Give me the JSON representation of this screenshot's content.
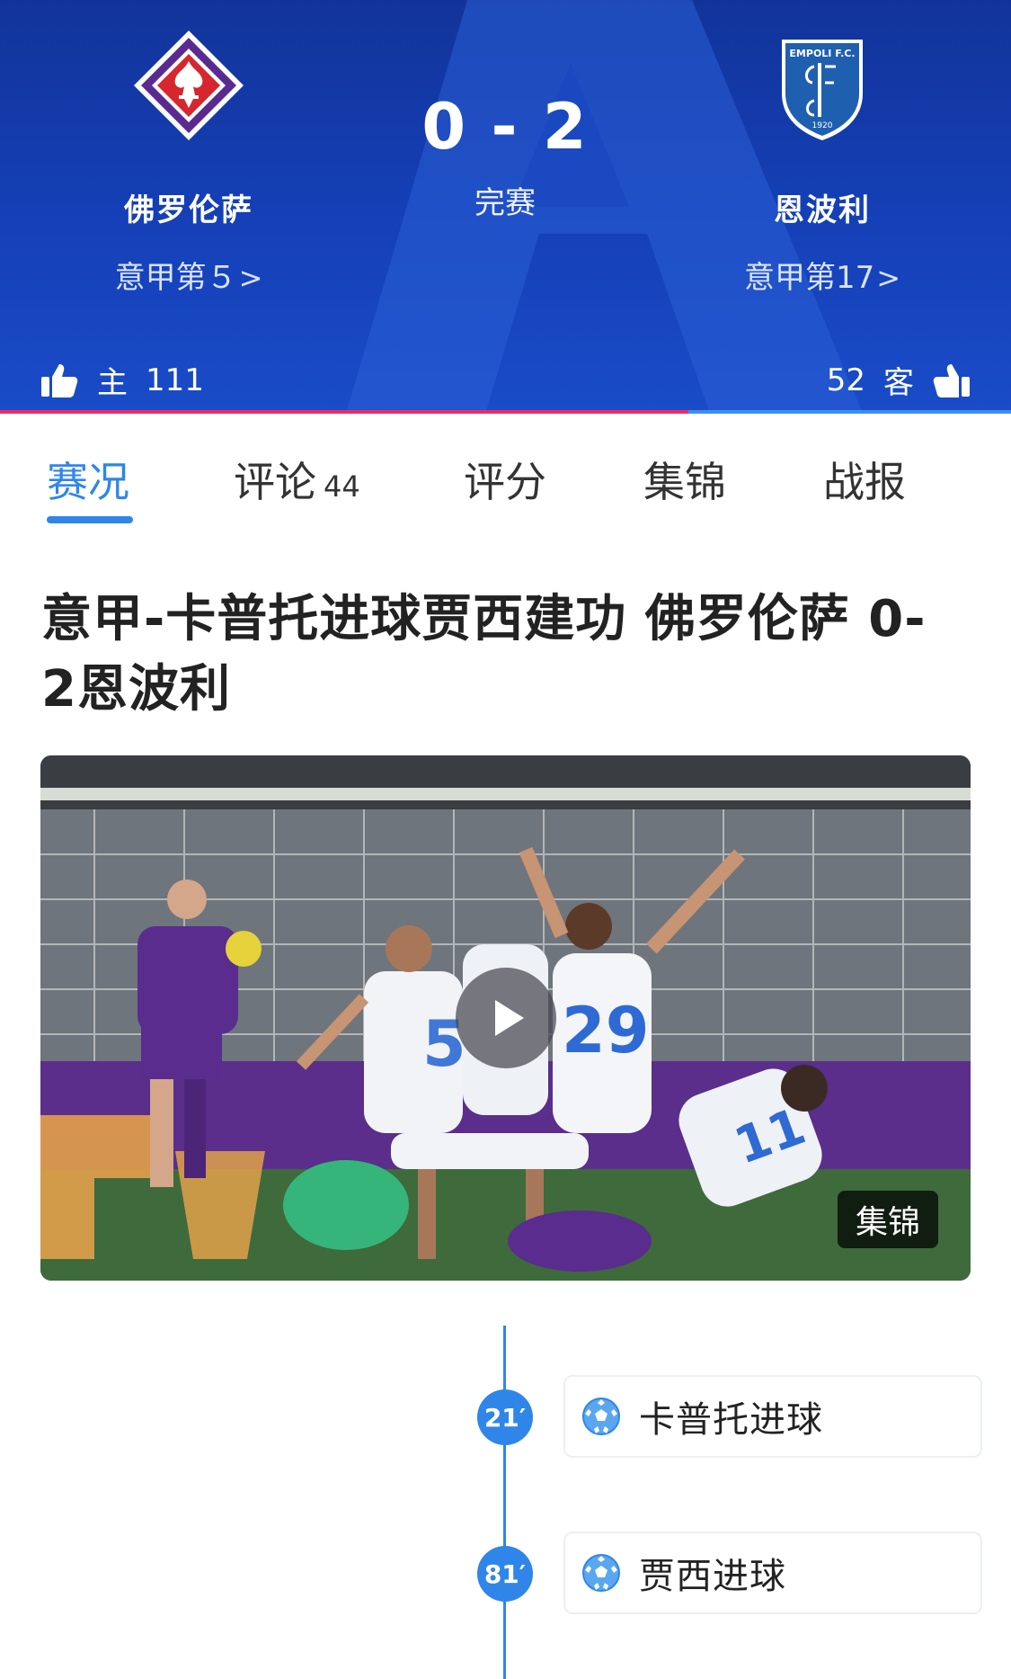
{
  "header": {
    "home": {
      "name": "佛罗伦萨",
      "rank": "意甲第５",
      "likes_label": "主",
      "likes": "111",
      "color": "#5b2a91"
    },
    "away": {
      "name": "恩波利",
      "rank": "意甲第17",
      "likes_label": "客",
      "likes": "52",
      "color": "#1f5fb0"
    },
    "score": "0 - 2",
    "status": "完赛",
    "support_split": {
      "home": 111,
      "away": 52,
      "home_color": "#ee2a67",
      "away_color": "#3e8ff0"
    },
    "logos": {
      "away_crest_text": "EMPOLI F.C.",
      "away_crest_year": "1920"
    }
  },
  "tabs": [
    {
      "label": "赛况",
      "active": true
    },
    {
      "label": "评论",
      "count": "44"
    },
    {
      "label": "评分"
    },
    {
      "label": "集锦"
    },
    {
      "label": "战报"
    }
  ],
  "article": {
    "headline": "意甲-卡普托进球贾西建功 佛罗伦萨 0-2恩波利"
  },
  "video": {
    "badge": "集锦",
    "icon": "play-icon"
  },
  "timeline": [
    {
      "minute": "21′",
      "event": "卡普托进球",
      "icon": "football-icon"
    },
    {
      "minute": "81′",
      "event": "贾西进球",
      "icon": "football-icon"
    }
  ],
  "colors": {
    "accent": "#2f86e8",
    "header_bg": "#1540b8"
  }
}
